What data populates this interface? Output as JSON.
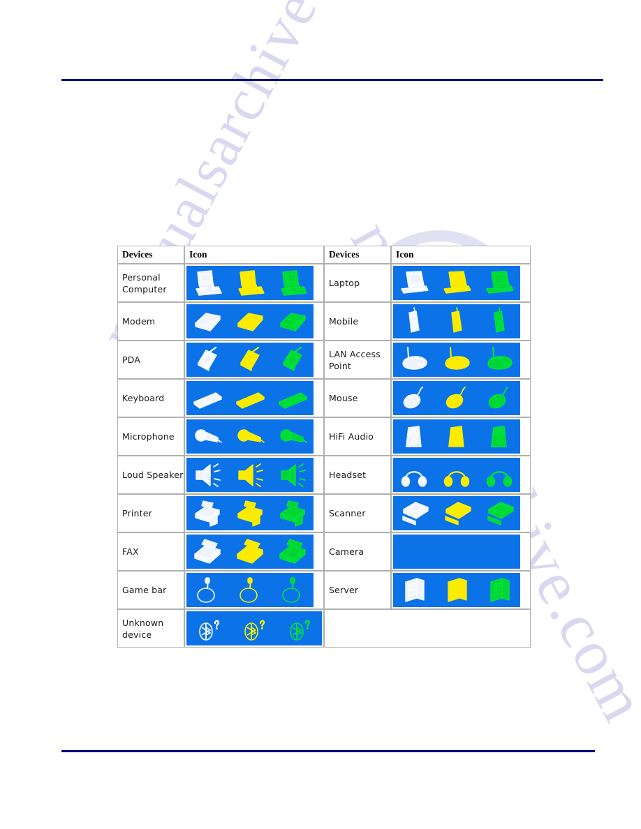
{
  "page": {
    "rule_color": "#000080",
    "icon_background": "#0b72e8",
    "watermark_text_1": "manualsarchive",
    "watermark_text_2": "manualsarchive.com"
  },
  "table": {
    "headers": {
      "devices_left": "Devices",
      "icon_left": "Icon",
      "devices_right": "Devices",
      "icon_right": "Icon"
    },
    "icon_variants": [
      "white",
      "yellow",
      "green"
    ],
    "rows": [
      {
        "left_label": "Personal Computer",
        "left_icon": "desktop-computer-icon",
        "right_label": "Laptop",
        "right_icon": "laptop-icon"
      },
      {
        "left_label": "Modem",
        "left_icon": "modem-icon",
        "right_label": "Mobile",
        "right_icon": "mobile-phone-icon"
      },
      {
        "left_label": "PDA",
        "left_icon": "pda-icon",
        "right_label": "LAN Access Point",
        "right_icon": "lan-access-point-icon"
      },
      {
        "left_label": "Keyboard",
        "left_icon": "keyboard-icon",
        "right_label": "Mouse",
        "right_icon": "mouse-icon"
      },
      {
        "left_label": "Microphone",
        "left_icon": "microphone-icon",
        "right_label": "HiFi Audio",
        "right_icon": "hifi-audio-icon"
      },
      {
        "left_label": "Loud Speaker",
        "left_icon": "loudspeaker-icon",
        "right_label": "Headset",
        "right_icon": "headset-icon"
      },
      {
        "left_label": "Printer",
        "left_icon": "printer-icon",
        "right_label": "Scanner",
        "right_icon": "scanner-icon"
      },
      {
        "left_label": "FAX",
        "left_icon": "fax-icon",
        "right_label": "Camera",
        "right_icon": "camera-icon"
      },
      {
        "left_label": "Game bar",
        "left_icon": "joystick-icon",
        "right_label": "Server",
        "right_icon": "server-icon"
      },
      {
        "left_label": "Unknown device",
        "left_icon": "unknown-device-icon",
        "right_label": "",
        "right_icon": ""
      }
    ]
  }
}
